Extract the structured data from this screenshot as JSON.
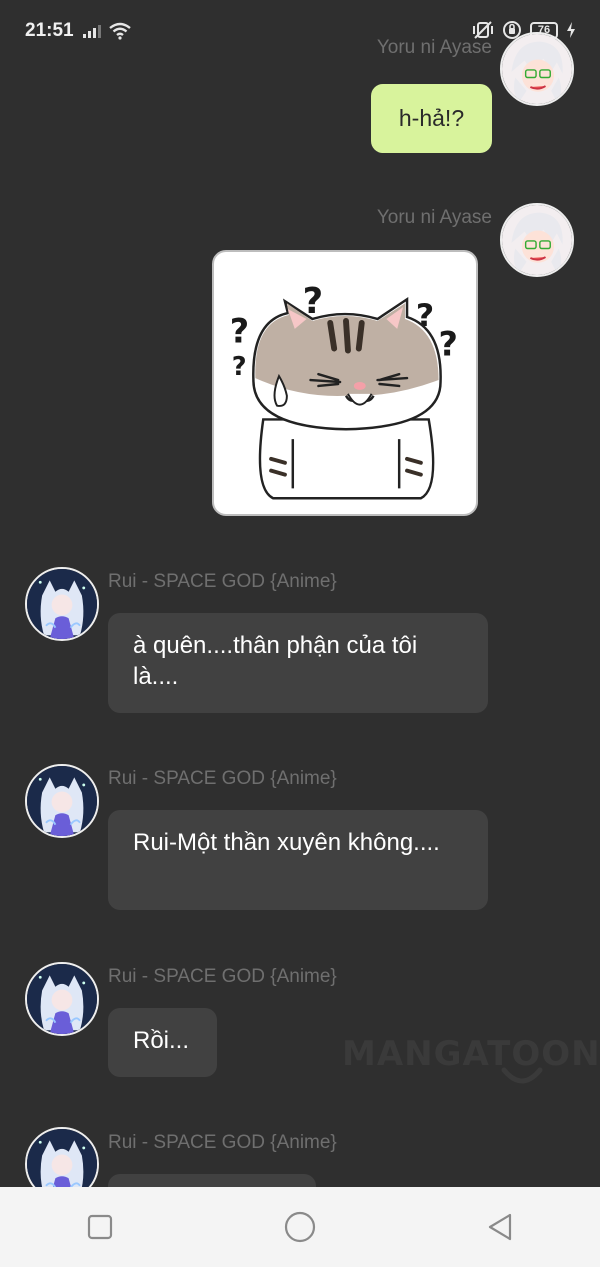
{
  "status_bar": {
    "time": "21:51",
    "battery": "76",
    "icons": [
      "signal-icon",
      "wifi-icon",
      "vibrate-icon",
      "alarm-icon",
      "battery-icon",
      "charging-icon"
    ]
  },
  "messages": [
    {
      "sender": "Yoru ni Ayase",
      "side": "right",
      "type": "text",
      "text": "h-hả!?"
    },
    {
      "sender": "Yoru ni Ayase",
      "side": "right",
      "type": "sticker",
      "sticker": "confused-cat-sticker"
    },
    {
      "sender": "Rui - SPACE GOD {Anime}",
      "side": "left",
      "type": "text",
      "text": "à quên....thân phận của tôi là...."
    },
    {
      "sender": "Rui - SPACE GOD {Anime}",
      "side": "left",
      "type": "text",
      "text": "Rui-Một thần xuyên không...."
    },
    {
      "sender": "Rui - SPACE GOD {Anime}",
      "side": "left",
      "type": "text",
      "text": "Rồi..."
    },
    {
      "sender": "Rui - SPACE GOD {Anime}",
      "side": "left",
      "type": "text",
      "text": ""
    }
  ],
  "watermark": "MANGATOON",
  "nav_bar": {
    "buttons": [
      "recent-apps-button",
      "home-button",
      "back-button"
    ]
  },
  "colors": {
    "background": "#2f2f2f",
    "my_bubble": "#d8f39c",
    "their_bubble": "#414141",
    "sender_name": "#6f6f6f"
  }
}
